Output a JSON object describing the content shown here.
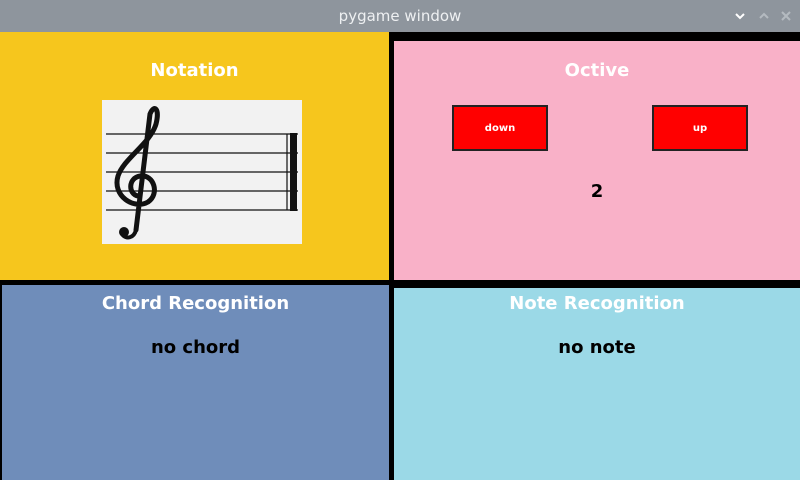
{
  "window": {
    "title": "pygame window",
    "controls": [
      "chevron-down-icon",
      "chevron-up-icon",
      "close-icon"
    ]
  },
  "colors": {
    "titlebar": "#8e959d",
    "notation": "#f6c61d",
    "octave": "#f9b1c8",
    "chord": "#6f8dba",
    "note": "#9bd9e7",
    "button": "#ff0000"
  },
  "notation": {
    "title": "Notation",
    "staff_icon": "treble-clef-staff"
  },
  "octave": {
    "title": "Octive",
    "down_label": "down",
    "up_label": "up",
    "value": "2"
  },
  "chord": {
    "title": "Chord Recognition",
    "value": "no chord"
  },
  "note": {
    "title": "Note Recognition",
    "value": "no note"
  }
}
